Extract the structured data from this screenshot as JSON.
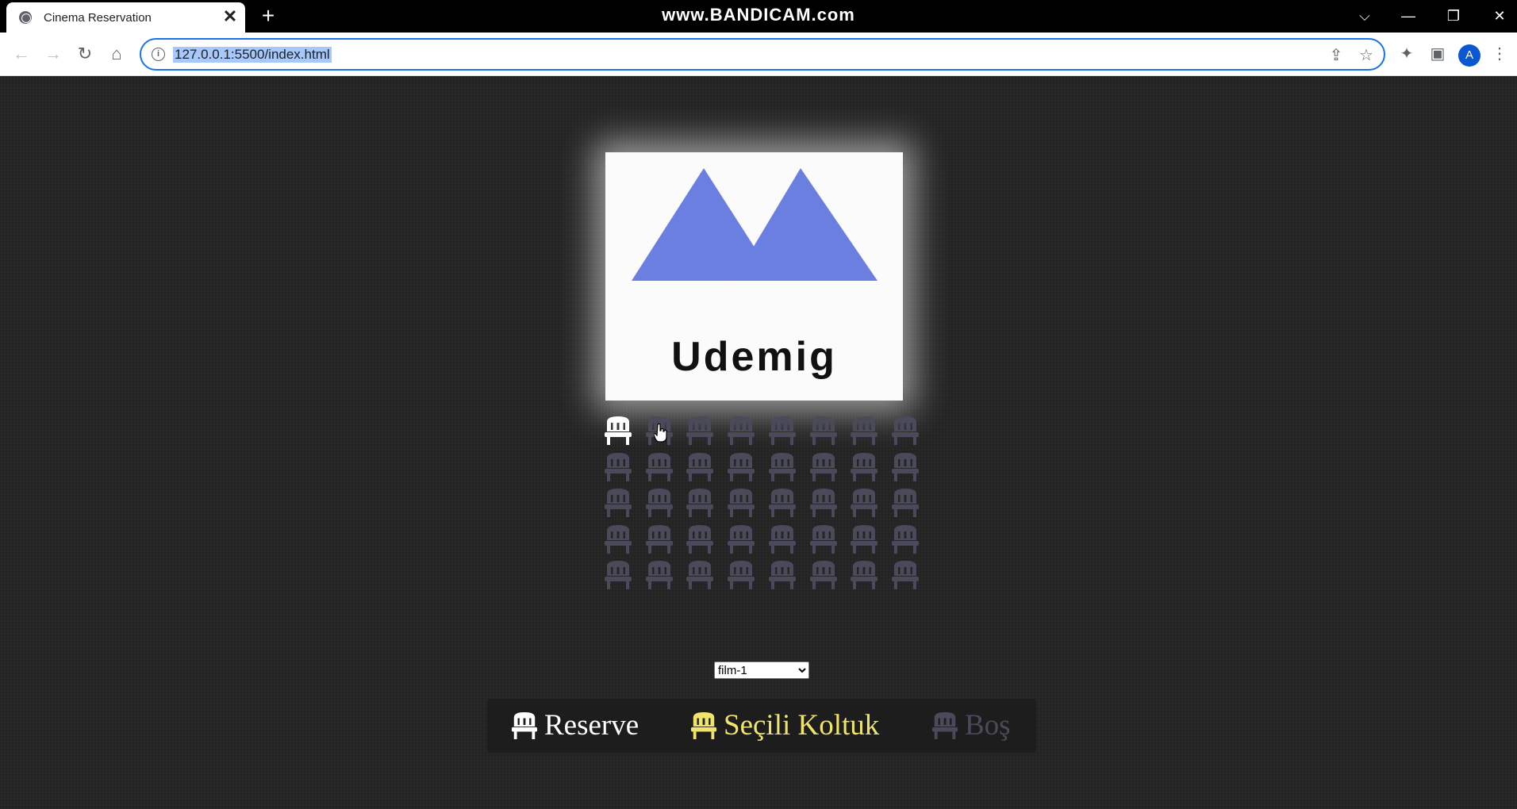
{
  "browser": {
    "tab_title": "Cinema Reservation",
    "tab_close": "✕",
    "new_tab": "+",
    "watermark": "www.BANDICAM.com",
    "url": "127.0.0.1:5500/index.html",
    "profile_initial": "A"
  },
  "screen": {
    "brand": "Udemig",
    "logo_color": "#6b7fe0"
  },
  "seats": {
    "rows": 5,
    "columns": 8,
    "colors": {
      "reserved": "#ffffff",
      "selected": "#f0e46a",
      "empty": "#4a4a5a"
    },
    "states": [
      [
        "reserved",
        "empty",
        "empty",
        "empty",
        "empty",
        "empty",
        "empty",
        "empty"
      ],
      [
        "empty",
        "empty",
        "empty",
        "empty",
        "empty",
        "empty",
        "empty",
        "empty"
      ],
      [
        "empty",
        "empty",
        "empty",
        "empty",
        "empty",
        "empty",
        "empty",
        "empty"
      ],
      [
        "empty",
        "empty",
        "empty",
        "empty",
        "empty",
        "empty",
        "empty",
        "empty"
      ],
      [
        "empty",
        "empty",
        "empty",
        "empty",
        "empty",
        "empty",
        "empty",
        "empty"
      ]
    ]
  },
  "movie_select": {
    "selected": "film-1",
    "options": [
      "film-1"
    ]
  },
  "legend": {
    "reserved_label": "Reserve",
    "selected_label": "Seçili Koltuk",
    "empty_label": "Boş",
    "reserved_color": "#ffffff",
    "selected_color": "#f0e46a",
    "empty_color": "#4a4a5a"
  }
}
